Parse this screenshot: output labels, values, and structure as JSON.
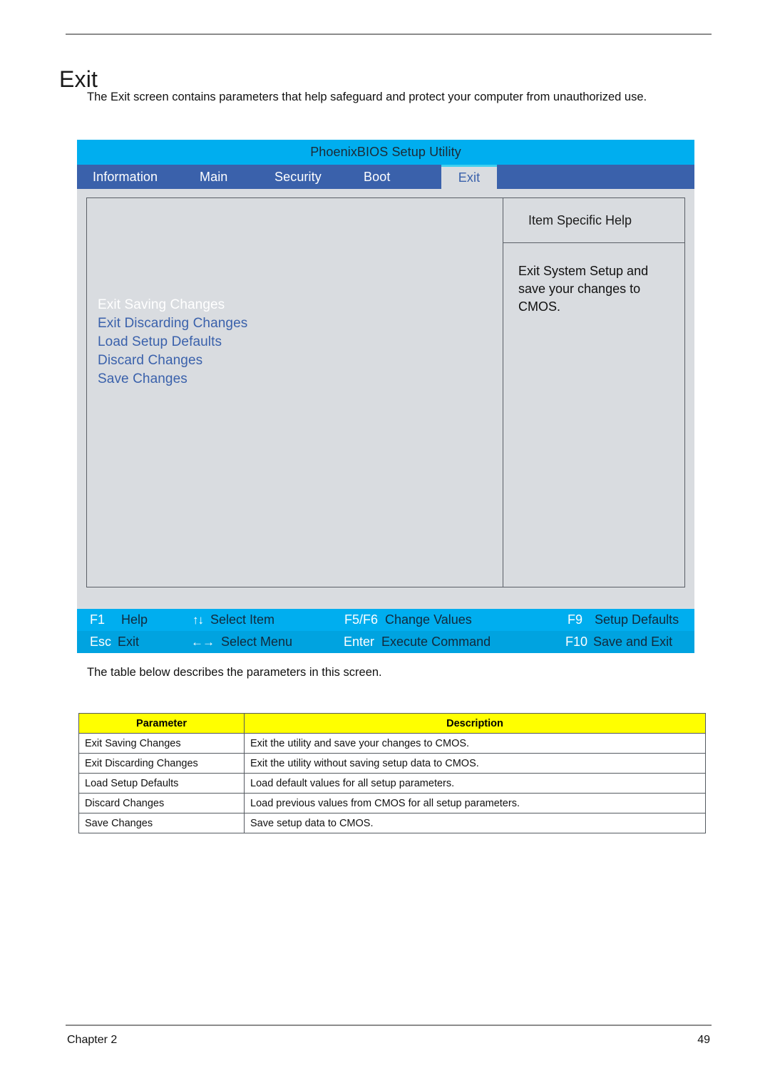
{
  "document": {
    "page_title": "Exit",
    "intro_text": "The Exit screen contains parameters that help safeguard and protect your computer from unauthorized use.",
    "mid_text": "The table below describes the parameters in this screen.",
    "footer_chapter": "Chapter 2",
    "footer_page_number": "49"
  },
  "bios": {
    "title": "PhoenixBIOS Setup Utility",
    "tabs": [
      {
        "label": "Information",
        "active": false
      },
      {
        "label": "Main",
        "active": false
      },
      {
        "label": "Security",
        "active": false
      },
      {
        "label": "Boot",
        "active": false
      },
      {
        "label": "Exit",
        "active": true
      }
    ],
    "menu_items": [
      {
        "label": "Exit Saving Changes",
        "selected": true
      },
      {
        "label": "Exit Discarding Changes",
        "selected": false
      },
      {
        "label": "Load Setup Defaults",
        "selected": false
      },
      {
        "label": "Discard Changes",
        "selected": false
      },
      {
        "label": "Save Changes",
        "selected": false
      }
    ],
    "help": {
      "heading": "Item Specific Help",
      "body": "Exit System Setup and save your changes to CMOS."
    },
    "keybar": [
      {
        "key": "F1",
        "glyph": "",
        "desc": "Help"
      },
      {
        "key": "",
        "glyph": "↑↓",
        "desc": "Select Item"
      },
      {
        "key": "F5/F6",
        "glyph": "",
        "desc": "Change Values"
      },
      {
        "key": "F9",
        "glyph": "",
        "desc": "Setup Defaults"
      },
      {
        "key": "Esc",
        "glyph": "",
        "desc": "Exit"
      },
      {
        "key": "",
        "glyph": "←→",
        "desc": "Select Menu"
      },
      {
        "key": "Enter",
        "glyph": "",
        "desc": "Execute  Command"
      },
      {
        "key": "F10",
        "glyph": "",
        "desc": "Save and Exit"
      }
    ],
    "colors": {
      "title_bar": "#00aeef",
      "tab_bar": "#3a61ab",
      "active_tab_bg": "#d9dce0",
      "active_tab_text": "#3a61ab",
      "panel_bg": "#d9dce0",
      "menu_text": "#3a61ab",
      "selected_menu_text": "#ffffff",
      "keybar_bg": "#00aeef"
    }
  },
  "table": {
    "headers": [
      "Parameter",
      "Description"
    ],
    "header_bg": "#ffff00",
    "rows": [
      [
        "Exit Saving Changes",
        "Exit the utility and save your changes to CMOS."
      ],
      [
        "Exit Discarding Changes",
        "Exit the utility without saving setup data to CMOS."
      ],
      [
        "Load Setup Defaults",
        "Load default values for all setup parameters."
      ],
      [
        "Discard Changes",
        "Load previous values from CMOS for all setup parameters."
      ],
      [
        "Save Changes",
        "Save setup data to CMOS."
      ]
    ]
  }
}
